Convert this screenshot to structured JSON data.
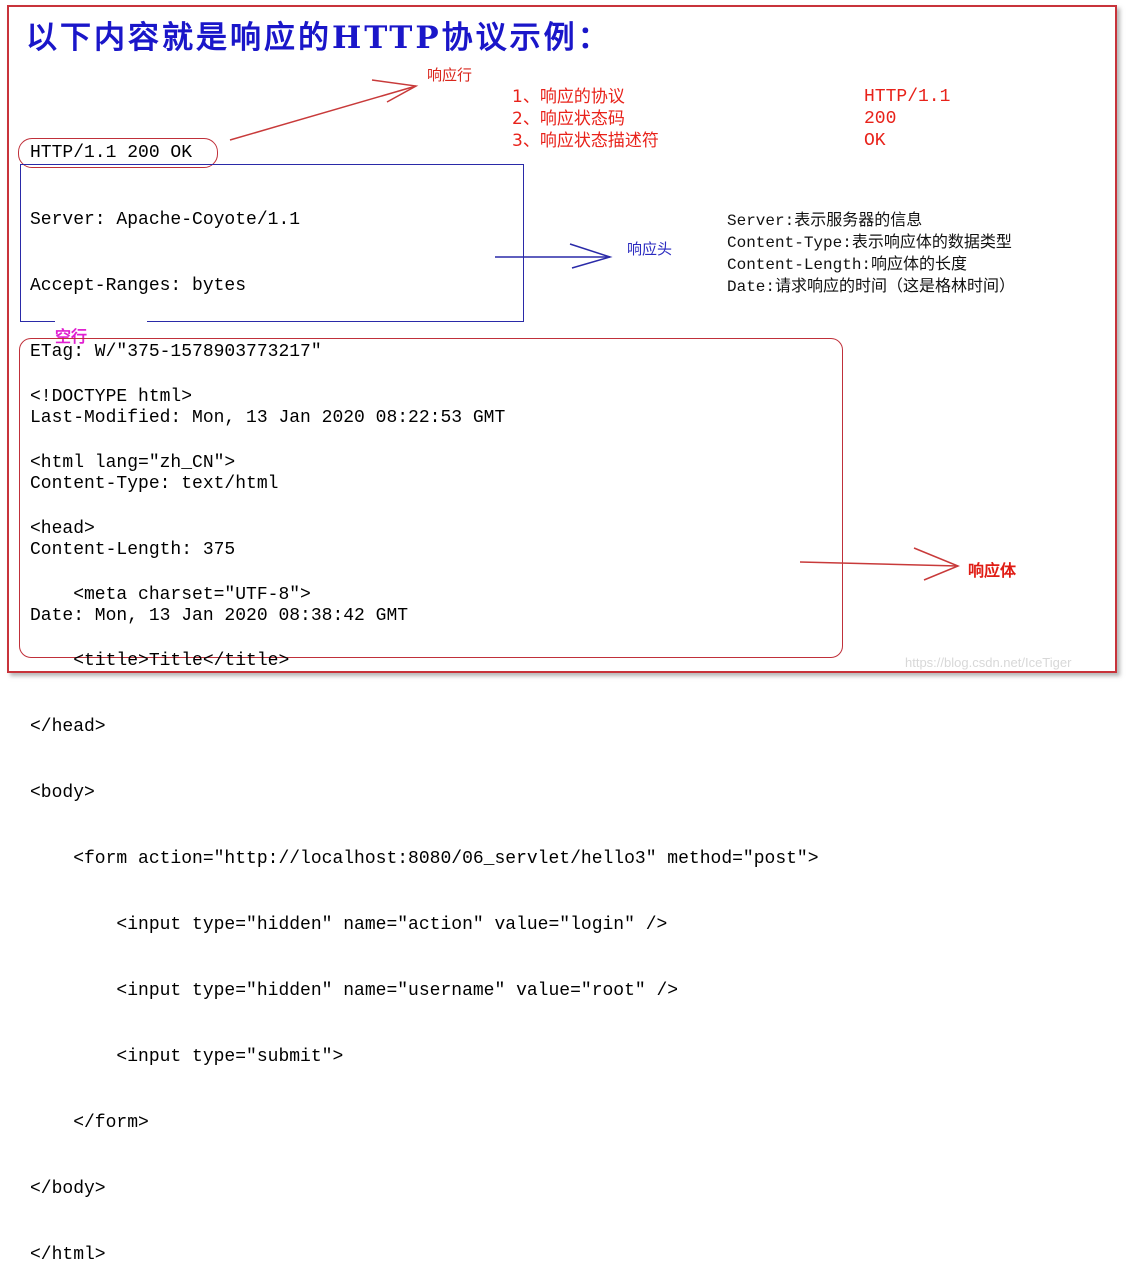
{
  "title": "以下内容就是响应的HTTP协议示例：",
  "annotations": {
    "status_line_label": "响应行",
    "headers_label": "响应头",
    "empty_line_label": "空行",
    "body_label": "响应体"
  },
  "protocol_breakdown": [
    {
      "key": "1、响应的协议",
      "value": "HTTP/1.1"
    },
    {
      "key": "2、响应状态码",
      "value": "200"
    },
    {
      "key": "3、响应状态描述符",
      "value": "OK"
    }
  ],
  "status_line": "HTTP/1.1 200 OK",
  "headers": [
    "Server: Apache-Coyote/1.1",
    "Accept-Ranges: bytes",
    "ETag: W/\"375-1578903773217\"",
    "Last-Modified: Mon, 13 Jan 2020 08:22:53 GMT",
    "Content-Type: text/html",
    "Content-Length: 375",
    "Date: Mon, 13 Jan 2020 08:38:42 GMT"
  ],
  "header_notes": [
    "Server:表示服务器的信息",
    "Content-Type:表示响应体的数据类型",
    "Content-Length:响应体的长度",
    "Date:请求响应的时间（这是格林时间）"
  ],
  "body_lines": [
    "<!DOCTYPE html>",
    "<html lang=\"zh_CN\">",
    "<head>",
    "    <meta charset=\"UTF-8\">",
    "    <title>Title</title>",
    "</head>",
    "<body>",
    "    <form action=\"http://localhost:8080/06_servlet/hello3\" method=\"post\">",
    "        <input type=\"hidden\" name=\"action\" value=\"login\" />",
    "        <input type=\"hidden\" name=\"username\" value=\"root\" />",
    "        <input type=\"submit\">",
    "    </form>",
    "</body>",
    "</html>"
  ],
  "watermark": "https://blog.csdn.net/IceTiger",
  "colors": {
    "title": "#1a16c9",
    "frame": "#c8333a",
    "red_annotation": "#e8221a",
    "blue_annotation": "#2a2ac0",
    "empty_line": "#e020d0"
  }
}
